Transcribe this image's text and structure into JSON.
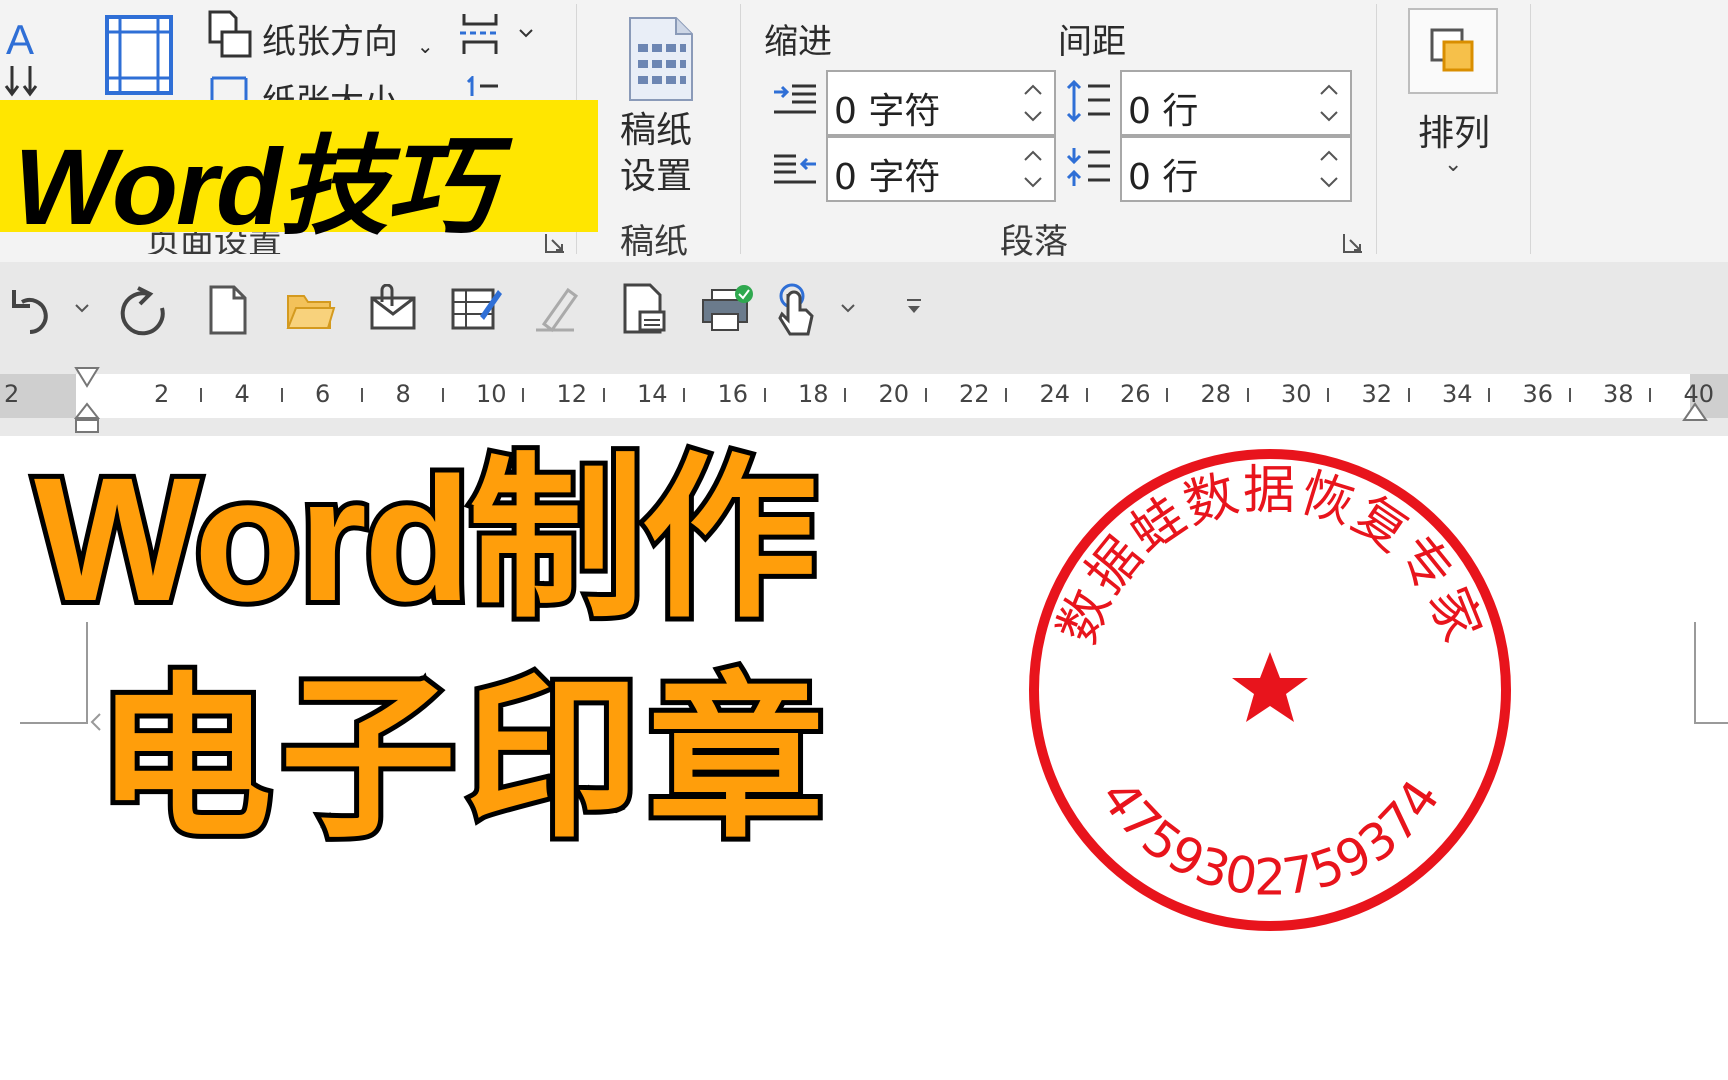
{
  "ribbon": {
    "page_setup": {
      "orientation_label": "纸张方向",
      "size_label": "纸张大小",
      "group_label": "页面设置"
    },
    "draft": {
      "button_line1": "稿纸",
      "button_line2": "设置",
      "group_label": "稿纸"
    },
    "paragraph": {
      "indent_header": "缩进",
      "spacing_header": "间距",
      "indent_left_value": "0 字符",
      "indent_right_value": "0 字符",
      "spacing_before_value": "0 行",
      "spacing_after_value": "0 行",
      "group_label": "段落"
    },
    "arrange": {
      "label": "排列"
    }
  },
  "overlay": {
    "banner_text": "Word技巧",
    "title_line1": "Word制作",
    "title_line2": "电子印章"
  },
  "ruler": {
    "numbers": [
      "2",
      "2",
      "4",
      "6",
      "8",
      "10",
      "12",
      "14",
      "16",
      "18",
      "20",
      "22",
      "24",
      "26",
      "28",
      "30",
      "32",
      "34",
      "36",
      "38",
      "40"
    ]
  },
  "seal": {
    "arc_text": "数据蛙数据恢复专家",
    "number_text": "4759302759374",
    "color": "#e8141c"
  },
  "colors": {
    "banner_bg": "#ffe600",
    "title_fill": "#ff9e0b",
    "title_stroke": "#000000",
    "ribbon_bg": "#f3f3f3"
  },
  "icons": {
    "qat": [
      "undo-icon",
      "undo-dropdown-icon",
      "redo-icon",
      "new-document-icon",
      "open-folder-icon",
      "email-attachment-icon",
      "edit-form-icon",
      "signature-icon",
      "print-preview-icon",
      "print-icon",
      "touch-mode-icon",
      "touch-dropdown-icon",
      "customize-qat-icon"
    ]
  }
}
